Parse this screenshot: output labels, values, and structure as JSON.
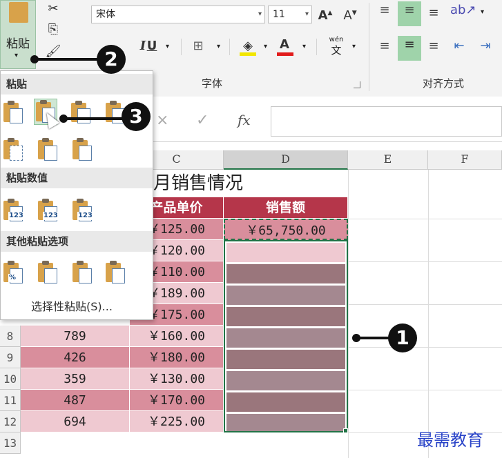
{
  "ribbon": {
    "paste_label": "粘贴",
    "font_name": "宋体",
    "font_size": "11",
    "font_group_label": "字体",
    "align_group_label": "对齐方式",
    "underline_label": "U",
    "wen_label": "wén",
    "wen_char": "文"
  },
  "paste_menu": {
    "section_paste": "粘贴",
    "section_values": "粘贴数值",
    "section_other": "其他粘贴选项",
    "paste_special": "选择性粘贴(S)...",
    "badge_123": "123",
    "badge_percent": "%"
  },
  "formula_bar": {
    "cancel": "×",
    "confirm": "✓",
    "fx": "fx"
  },
  "columns": [
    "C",
    "D",
    "E",
    "F"
  ],
  "sheet": {
    "title": "月销售情况",
    "header_price": "产品单价",
    "header_sales": "销售额",
    "selected_value": "￥65,750.00",
    "prices": [
      "￥125.00",
      "￥120.00",
      "￥110.00",
      "￥189.00",
      "￥175.00",
      "￥160.00",
      "￥180.00",
      "￥130.00",
      "￥170.00",
      "￥225.00"
    ],
    "rows": [
      {
        "row": "8",
        "qty": "789"
      },
      {
        "row": "9",
        "qty": "426"
      },
      {
        "row": "10",
        "qty": "359"
      },
      {
        "row": "11",
        "qty": "487"
      },
      {
        "row": "12",
        "qty": "694"
      },
      {
        "row": "13",
        "qty": ""
      }
    ]
  },
  "callouts": [
    "1",
    "2",
    "3"
  ],
  "watermark": "最需教育",
  "colors": {
    "header_red": "#b5364a",
    "pink_light": "#efc9d1",
    "pink_dark": "#d98e9c",
    "selection_fill": "#9a767c",
    "selection_border": "#217346"
  }
}
